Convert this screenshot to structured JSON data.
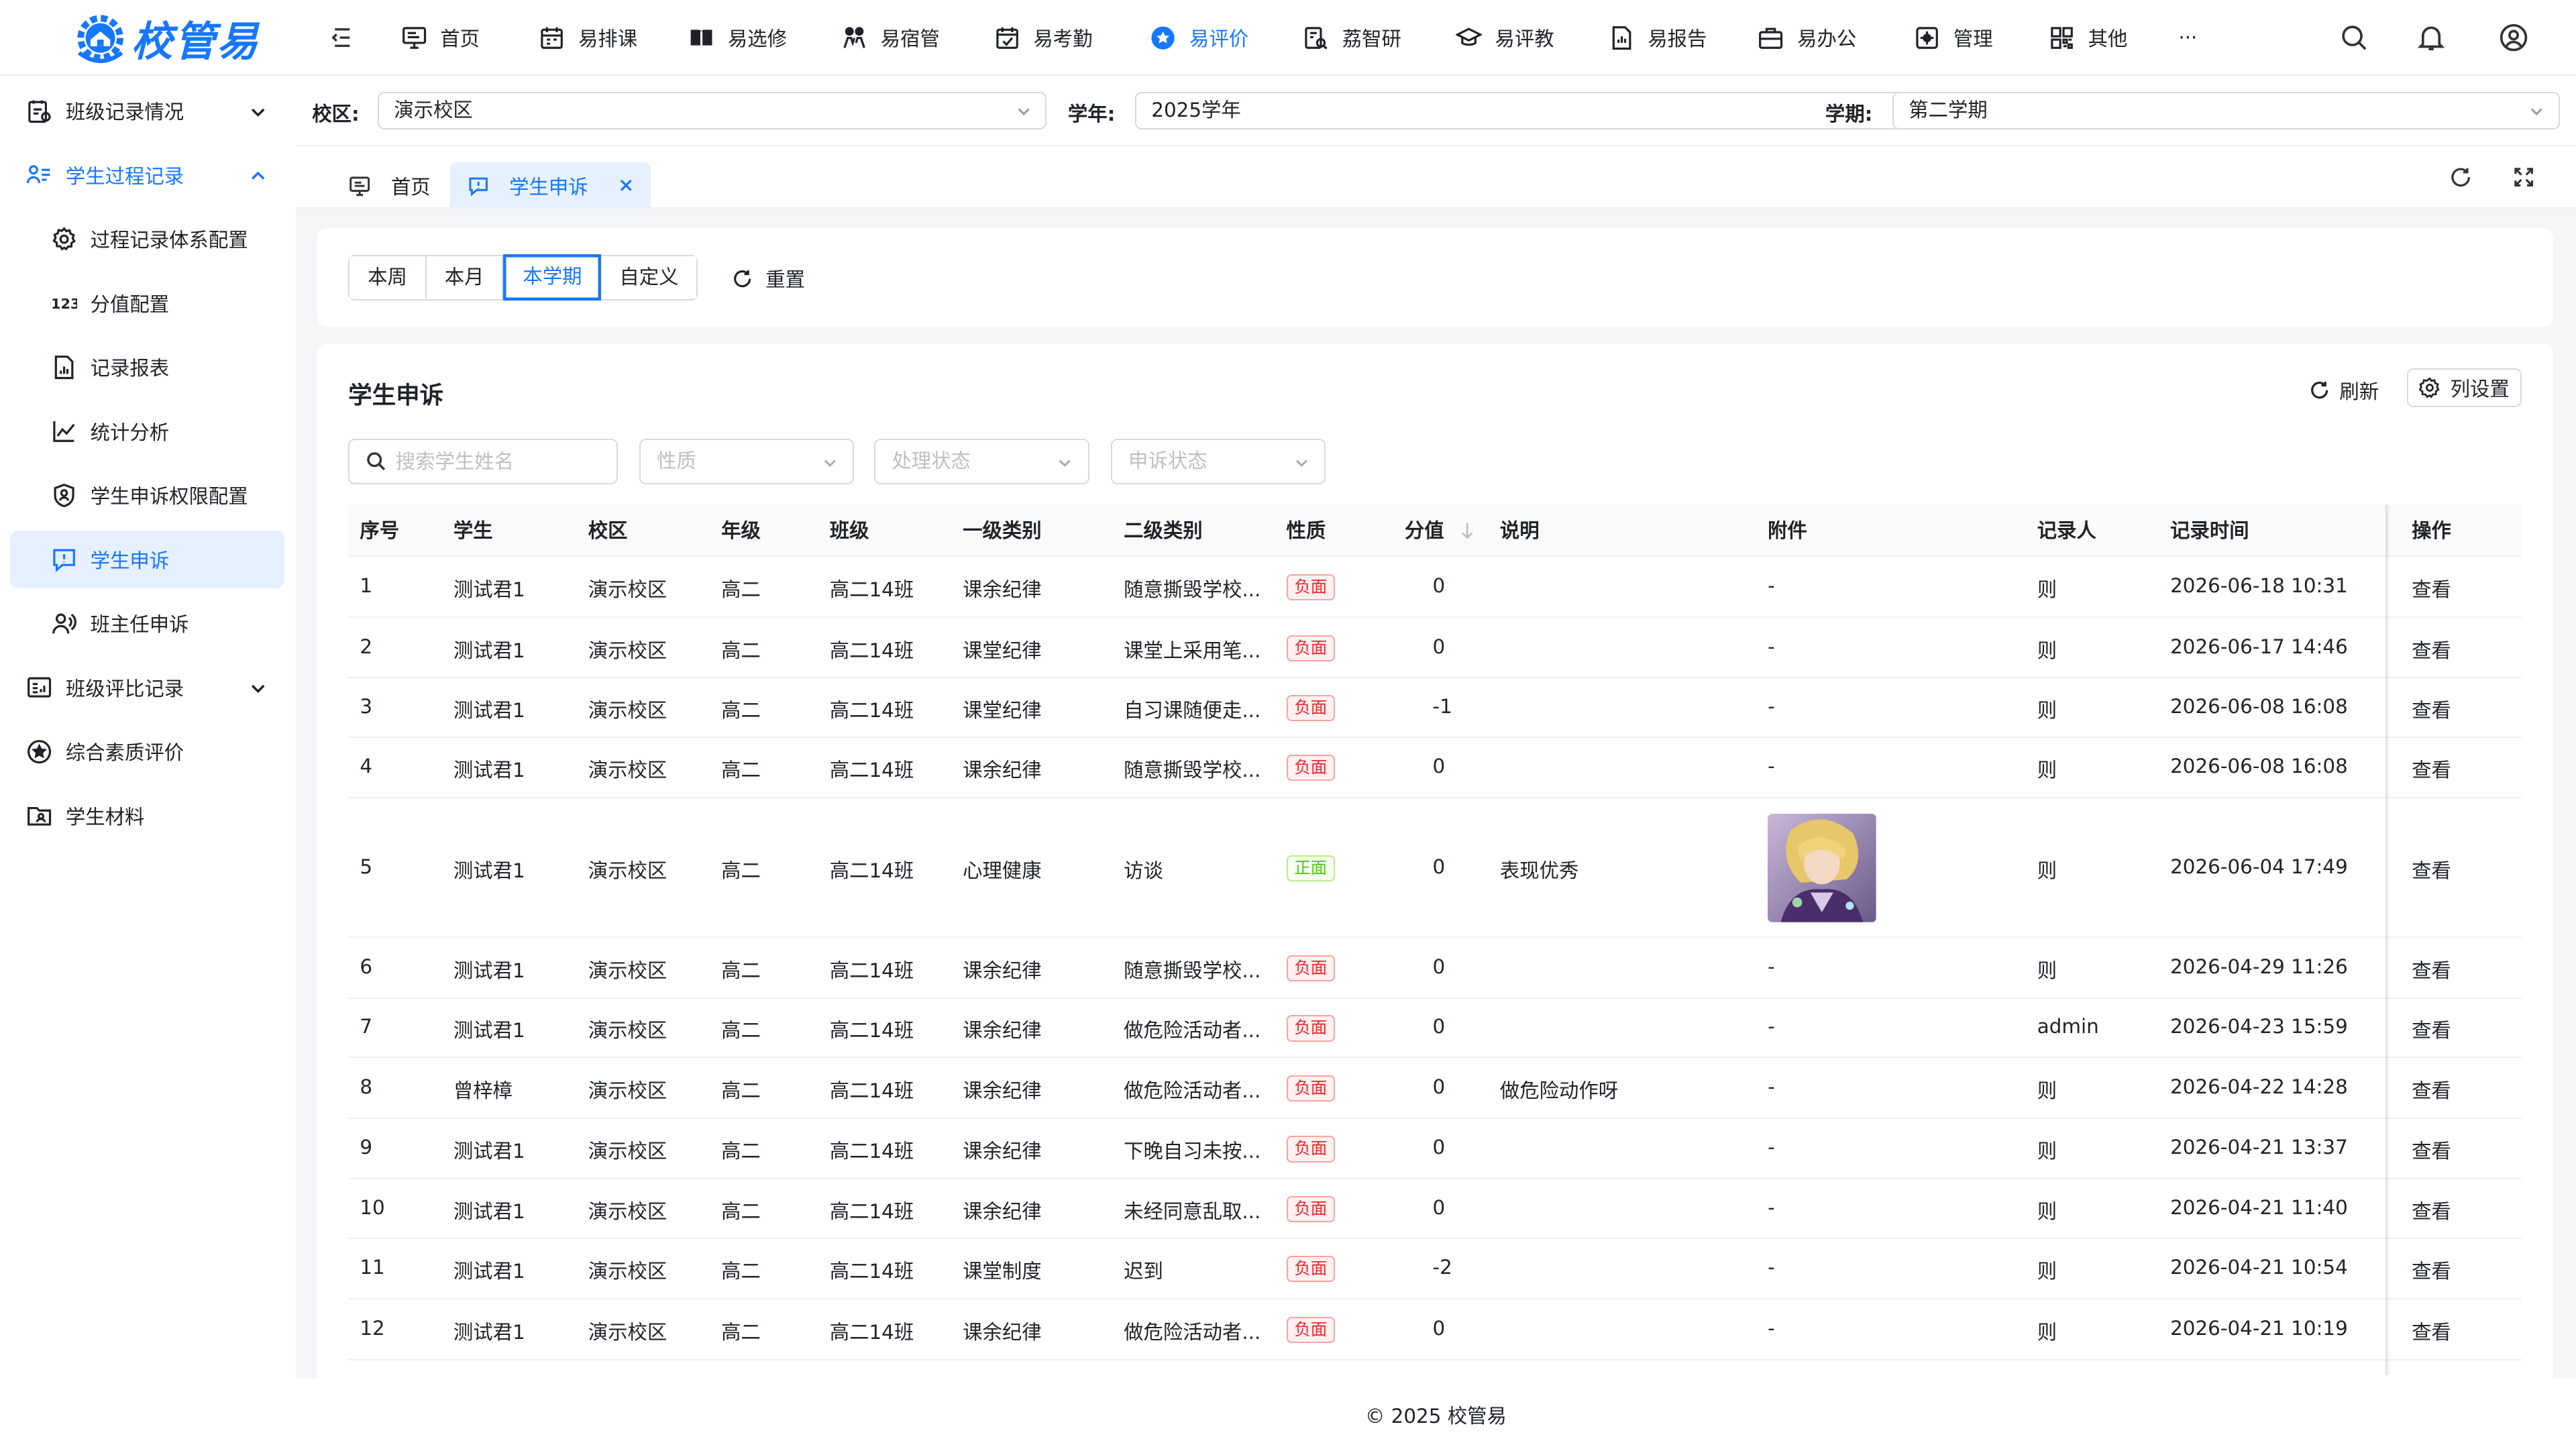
{
  "brand": {
    "name": "校管易",
    "color": "#1677ff"
  },
  "topnav": [
    {
      "label": "首页",
      "icon": "monitor-icon"
    },
    {
      "label": "易排课",
      "icon": "calendar-icon"
    },
    {
      "label": "易选修",
      "icon": "book-icon"
    },
    {
      "label": "易宿管",
      "icon": "people-icon"
    },
    {
      "label": "易考勤",
      "icon": "calendar-check-icon"
    },
    {
      "label": "易评价",
      "icon": "star-badge-icon",
      "active": true
    },
    {
      "label": "荔智研",
      "icon": "research-icon"
    },
    {
      "label": "易评教",
      "icon": "graduation-cap-icon"
    },
    {
      "label": "易报告",
      "icon": "report-icon"
    },
    {
      "label": "易办公",
      "icon": "briefcase-icon"
    },
    {
      "label": "管理",
      "icon": "settings-box-icon"
    },
    {
      "label": "其他",
      "icon": "grid-icon"
    },
    {
      "label": "···",
      "icon": ""
    }
  ],
  "sidebar": {
    "items": [
      {
        "label": "班级记录情况",
        "icon": "class-record-icon"
      },
      {
        "label": "学生过程记录",
        "icon": "student-list-icon"
      },
      {
        "label": "过程记录体系配置",
        "icon": "gear-icon"
      },
      {
        "label": "分值配置",
        "icon": "numbers-icon"
      },
      {
        "label": "记录报表",
        "icon": "file-chart-icon"
      },
      {
        "label": "统计分析",
        "icon": "line-chart-icon"
      },
      {
        "label": "学生申诉权限配置",
        "icon": "shield-user-icon"
      },
      {
        "label": "学生申诉",
        "icon": "message-alert-icon"
      },
      {
        "label": "班主任申诉",
        "icon": "teacher-icon"
      },
      {
        "label": "班级评比记录",
        "icon": "board-icon"
      },
      {
        "label": "综合素质评价",
        "icon": "star-circle-icon"
      },
      {
        "label": "学生材料",
        "icon": "folder-user-icon"
      }
    ]
  },
  "filters": {
    "campus_label": "校区:",
    "campus_value": "演示校区",
    "year_label": "学年:",
    "year_value": "2025学年",
    "term_label": "学期:",
    "term_value": "第二学期"
  },
  "tabs": [
    {
      "label": "首页"
    },
    {
      "label": "学生申诉",
      "active": true
    }
  ],
  "range": {
    "options": [
      "本周",
      "本月",
      "本学期",
      "自定义"
    ],
    "active": "本学期",
    "reset_label": "重置"
  },
  "card": {
    "title": "学生申诉",
    "refresh_label": "刷新",
    "column_settings_label": "列设置"
  },
  "search": {
    "placeholder": "搜索学生姓名",
    "nature_placeholder": "性质",
    "process_placeholder": "处理状态",
    "appeal_placeholder": "申诉状态"
  },
  "table": {
    "columns": [
      "序号",
      "学生",
      "校区",
      "年级",
      "班级",
      "一级类别",
      "二级类别",
      "性质",
      "分值",
      "说明",
      "附件",
      "记录人",
      "记录时间",
      "操作"
    ],
    "rows": [
      {
        "no": "1",
        "student": "测试君1",
        "campus": "演示校区",
        "grade": "高二",
        "class": "高二14班",
        "cat1": "课余纪律",
        "cat2": "随意撕毁学校...",
        "nature": "负面",
        "score": "0",
        "note": "",
        "attach": "-",
        "recorder": "则",
        "time": "2026-06-18 10:31",
        "action": "查看"
      },
      {
        "no": "2",
        "student": "测试君1",
        "campus": "演示校区",
        "grade": "高二",
        "class": "高二14班",
        "cat1": "课堂纪律",
        "cat2": "课堂上采用笔...",
        "nature": "负面",
        "score": "0",
        "note": "",
        "attach": "-",
        "recorder": "则",
        "time": "2026-06-17 14:46",
        "action": "查看"
      },
      {
        "no": "3",
        "student": "测试君1",
        "campus": "演示校区",
        "grade": "高二",
        "class": "高二14班",
        "cat1": "课堂纪律",
        "cat2": "自习课随便走...",
        "nature": "负面",
        "score": "-1",
        "note": "",
        "attach": "-",
        "recorder": "则",
        "time": "2026-06-08 16:08",
        "action": "查看"
      },
      {
        "no": "4",
        "student": "测试君1",
        "campus": "演示校区",
        "grade": "高二",
        "class": "高二14班",
        "cat1": "课余纪律",
        "cat2": "随意撕毁学校...",
        "nature": "负面",
        "score": "0",
        "note": "",
        "attach": "-",
        "recorder": "则",
        "time": "2026-06-08 16:08",
        "action": "查看"
      },
      {
        "no": "5",
        "student": "测试君1",
        "campus": "演示校区",
        "grade": "高二",
        "class": "高二14班",
        "cat1": "心理健康",
        "cat2": "访谈",
        "nature": "正面",
        "score": "0",
        "note": "表现优秀",
        "attach": "",
        "has_image": true,
        "recorder": "则",
        "time": "2026-06-04 17:49",
        "action": "查看"
      },
      {
        "no": "6",
        "student": "测试君1",
        "campus": "演示校区",
        "grade": "高二",
        "class": "高二14班",
        "cat1": "课余纪律",
        "cat2": "随意撕毁学校...",
        "nature": "负面",
        "score": "0",
        "note": "",
        "attach": "-",
        "recorder": "则",
        "time": "2026-04-29 11:26",
        "action": "查看"
      },
      {
        "no": "7",
        "student": "测试君1",
        "campus": "演示校区",
        "grade": "高二",
        "class": "高二14班",
        "cat1": "课余纪律",
        "cat2": "做危险活动者...",
        "nature": "负面",
        "score": "0",
        "note": "",
        "attach": "-",
        "recorder": "admin",
        "time": "2026-04-23 15:59",
        "action": "查看"
      },
      {
        "no": "8",
        "student": "曾梓樟",
        "campus": "演示校区",
        "grade": "高二",
        "class": "高二14班",
        "cat1": "课余纪律",
        "cat2": "做危险活动者...",
        "nature": "负面",
        "score": "0",
        "note": "做危险动作呀",
        "attach": "-",
        "recorder": "则",
        "time": "2026-04-22 14:28",
        "action": "查看"
      },
      {
        "no": "9",
        "student": "测试君1",
        "campus": "演示校区",
        "grade": "高二",
        "class": "高二14班",
        "cat1": "课余纪律",
        "cat2": "下晚自习未按...",
        "nature": "负面",
        "score": "0",
        "note": "",
        "attach": "-",
        "recorder": "则",
        "time": "2026-04-21 13:37",
        "action": "查看"
      },
      {
        "no": "10",
        "student": "测试君1",
        "campus": "演示校区",
        "grade": "高二",
        "class": "高二14班",
        "cat1": "课余纪律",
        "cat2": "未经同意乱取...",
        "nature": "负面",
        "score": "0",
        "note": "",
        "attach": "-",
        "recorder": "则",
        "time": "2026-04-21 11:40",
        "action": "查看"
      },
      {
        "no": "11",
        "student": "测试君1",
        "campus": "演示校区",
        "grade": "高二",
        "class": "高二14班",
        "cat1": "课堂制度",
        "cat2": "迟到",
        "nature": "负面",
        "score": "-2",
        "note": "",
        "attach": "-",
        "recorder": "则",
        "time": "2026-04-21 10:54",
        "action": "查看"
      },
      {
        "no": "12",
        "student": "测试君1",
        "campus": "演示校区",
        "grade": "高二",
        "class": "高二14班",
        "cat1": "课余纪律",
        "cat2": "做危险活动者...",
        "nature": "负面",
        "score": "0",
        "note": "",
        "attach": "-",
        "recorder": "则",
        "time": "2026-04-21 10:19",
        "action": "查看"
      }
    ]
  },
  "footer": {
    "copyright": "© 2025 校管易"
  }
}
